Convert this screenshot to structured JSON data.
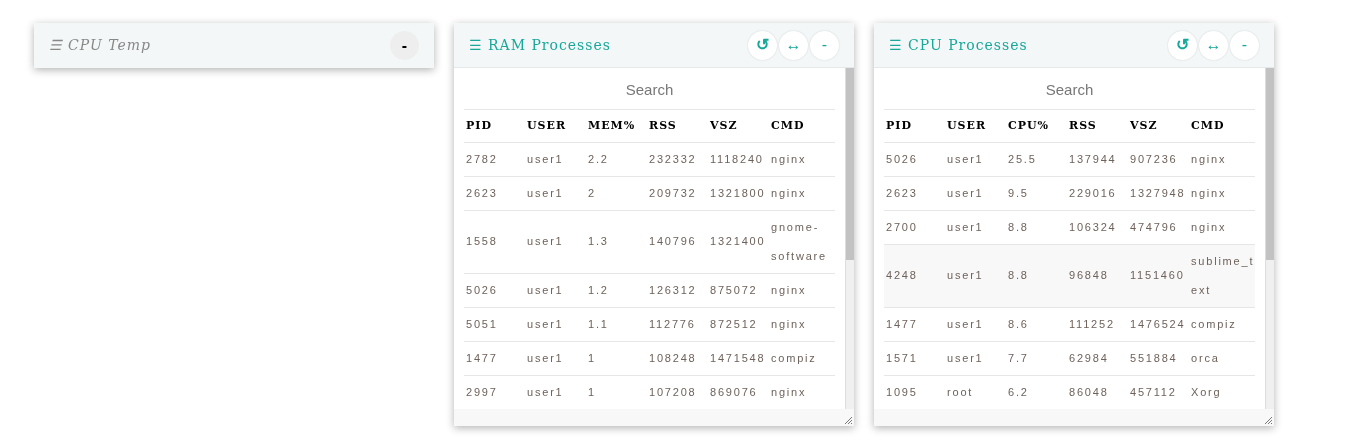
{
  "panels": [
    {
      "menu_icon": "☰",
      "title": "CPU Temp",
      "collapsed": true,
      "buttons": [
        {
          "kind": "minimize",
          "label": "-"
        }
      ]
    },
    {
      "menu_icon": "☰",
      "title": "RAM Processes",
      "collapsed": false,
      "buttons": [
        {
          "kind": "refresh",
          "label": "↺"
        },
        {
          "kind": "expand",
          "label": "↔"
        },
        {
          "kind": "minimize",
          "label": "-"
        }
      ],
      "search": {
        "placeholder": "Search"
      },
      "table": {
        "columns": [
          "PID",
          "USER",
          "MEM%",
          "RSS",
          "VSZ",
          "CMD"
        ],
        "rows": [
          {
            "cells": [
              "2782",
              "user1",
              "2.2",
              "232332",
              "1118240",
              "nginx"
            ],
            "highlighted": false
          },
          {
            "cells": [
              "2623",
              "user1",
              "2",
              "209732",
              "1321800",
              "nginx"
            ],
            "highlighted": false
          },
          {
            "cells": [
              "1558",
              "user1",
              "1.3",
              "140796",
              "1321400",
              "gnome-software"
            ],
            "highlighted": false
          },
          {
            "cells": [
              "5026",
              "user1",
              "1.2",
              "126312",
              "875072",
              "nginx"
            ],
            "highlighted": false
          },
          {
            "cells": [
              "5051",
              "user1",
              "1.1",
              "112776",
              "872512",
              "nginx"
            ],
            "highlighted": false
          },
          {
            "cells": [
              "1477",
              "user1",
              "1",
              "108248",
              "1471548",
              "compiz"
            ],
            "highlighted": false
          },
          {
            "cells": [
              "2997",
              "user1",
              "1",
              "107208",
              "869076",
              "nginx"
            ],
            "highlighted": false
          }
        ]
      }
    },
    {
      "menu_icon": "☰",
      "title": "CPU Processes",
      "collapsed": false,
      "buttons": [
        {
          "kind": "refresh",
          "label": "↺"
        },
        {
          "kind": "expand",
          "label": "↔"
        },
        {
          "kind": "minimize",
          "label": "-"
        }
      ],
      "search": {
        "placeholder": "Search"
      },
      "table": {
        "columns": [
          "PID",
          "USER",
          "CPU%",
          "RSS",
          "VSZ",
          "CMD"
        ],
        "rows": [
          {
            "cells": [
              "5026",
              "user1",
              "25.5",
              "137944",
              "907236",
              "nginx"
            ],
            "highlighted": false
          },
          {
            "cells": [
              "2623",
              "user1",
              "9.5",
              "229016",
              "1327948",
              "nginx"
            ],
            "highlighted": false
          },
          {
            "cells": [
              "2700",
              "user1",
              "8.8",
              "106324",
              "474796",
              "nginx"
            ],
            "highlighted": false
          },
          {
            "cells": [
              "4248",
              "user1",
              "8.8",
              "96848",
              "1151460",
              "sublime_text"
            ],
            "highlighted": true
          },
          {
            "cells": [
              "1477",
              "user1",
              "8.6",
              "111252",
              "1476524",
              "compiz"
            ],
            "highlighted": false
          },
          {
            "cells": [
              "1571",
              "user1",
              "7.7",
              "62984",
              "551884",
              "orca"
            ],
            "highlighted": false
          },
          {
            "cells": [
              "1095",
              "root",
              "6.2",
              "86048",
              "457112",
              "Xorg"
            ],
            "highlighted": false
          }
        ]
      }
    }
  ]
}
